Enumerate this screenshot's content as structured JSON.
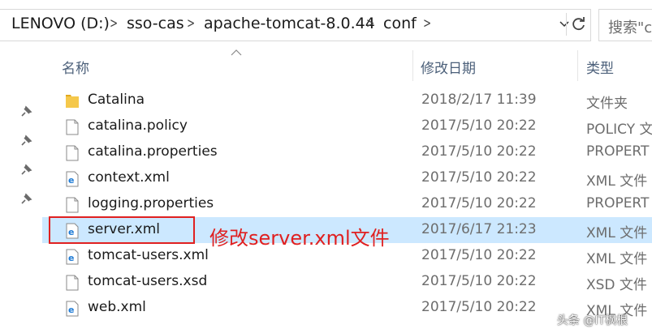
{
  "address_bar": {
    "breadcrumbs": [
      "LENOVO (D:)",
      "sso-cas",
      "apache-tomcat-8.0.44",
      "conf"
    ],
    "search_placeholder": "搜索\"c"
  },
  "columns": {
    "name": "名称",
    "modified": "修改日期",
    "type": "类型"
  },
  "files": [
    {
      "name": "Catalina",
      "date": "2018/2/17 11:39",
      "type": "文件夹",
      "icon": "folder-icon",
      "selected": false
    },
    {
      "name": "catalina.policy",
      "date": "2017/5/10 20:22",
      "type": "POLICY 文",
      "icon": "file-icon",
      "selected": false
    },
    {
      "name": "catalina.properties",
      "date": "2017/5/10 20:22",
      "type": "PROPERT",
      "icon": "file-icon",
      "selected": false
    },
    {
      "name": "context.xml",
      "date": "2017/5/10 20:22",
      "type": "XML 文件",
      "icon": "xml-file-icon",
      "selected": false
    },
    {
      "name": "logging.properties",
      "date": "2017/5/10 20:22",
      "type": "PROPERT",
      "icon": "file-icon",
      "selected": false
    },
    {
      "name": "server.xml",
      "date": "2017/6/17 21:23",
      "type": "XML 文件",
      "icon": "xml-file-icon",
      "selected": true
    },
    {
      "name": "tomcat-users.xml",
      "date": "2017/5/10 20:22",
      "type": "XML 文件",
      "icon": "xml-file-icon",
      "selected": false
    },
    {
      "name": "tomcat-users.xsd",
      "date": "2017/5/10 20:22",
      "type": "XSD 文件",
      "icon": "file-icon",
      "selected": false
    },
    {
      "name": "web.xml",
      "date": "2017/5/10 20:22",
      "type": "XML 文件",
      "icon": "xml-file-icon",
      "selected": false
    }
  ],
  "annotation": "修改server.xml文件",
  "watermark": "头条 @IT枫根",
  "colors": {
    "selection": "#cce8ff",
    "annotation": "#e02020",
    "folder": "#f5c84b",
    "xml_icon": "#1e7bd6"
  }
}
